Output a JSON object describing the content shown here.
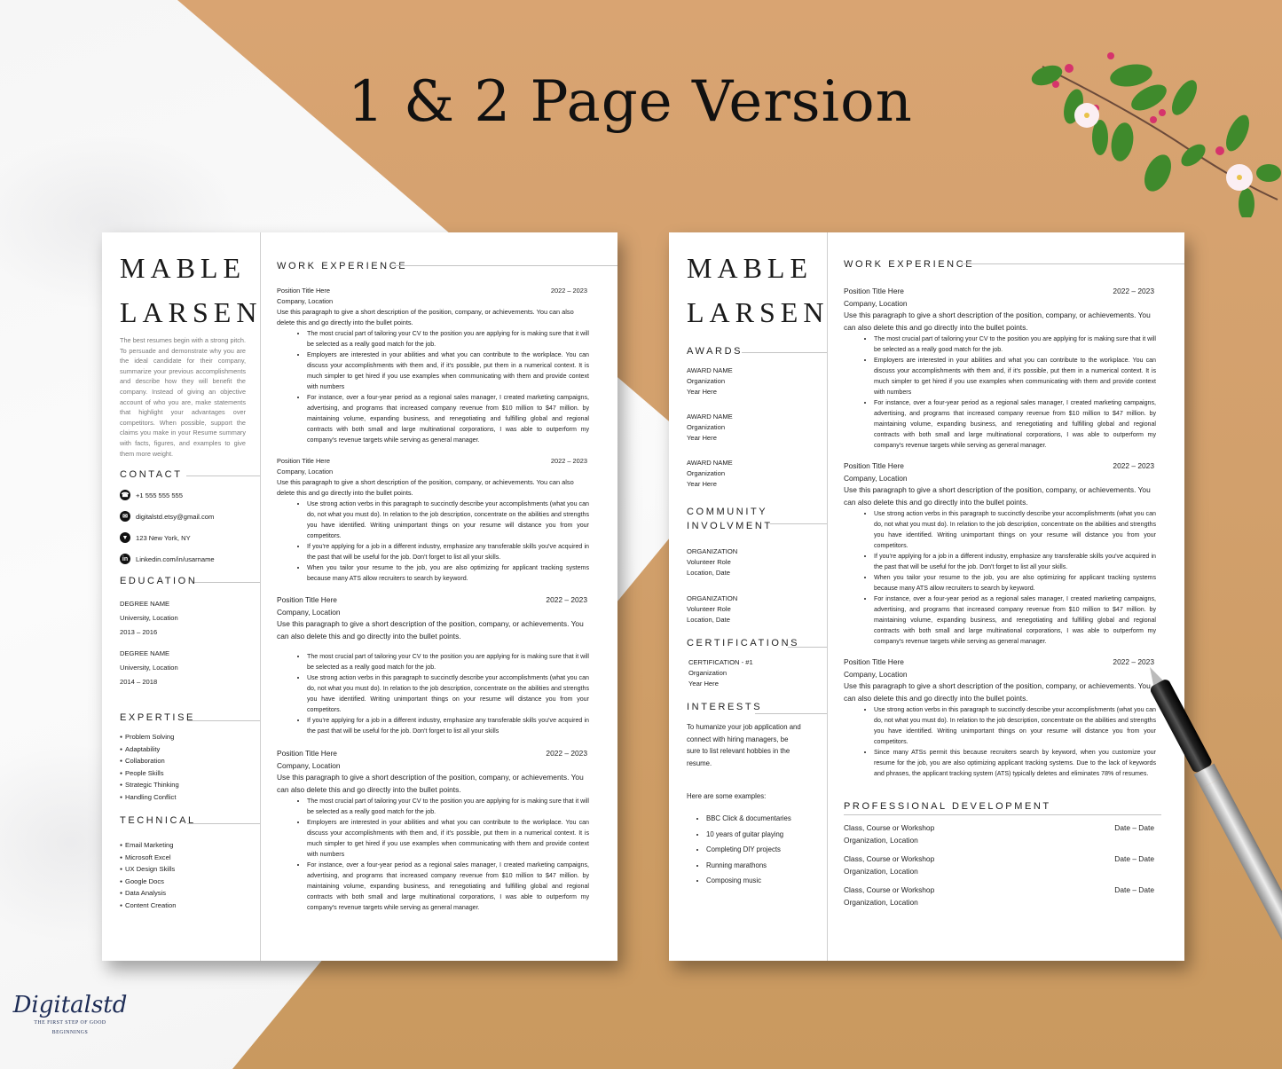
{
  "headline": "1 & 2 Page Version",
  "brand": {
    "name": "Digitalstd",
    "tagline_1": "THE FIRST STEP OF GOOD",
    "tagline_2": "BEGINNINGS",
    "color": "#1c2b55"
  },
  "colors": {
    "copper": "#d4a06d",
    "marble": "#f6f6f6",
    "text": "#222222",
    "summary_text": "#777777"
  },
  "person": {
    "first_name": "MABLE",
    "last_name": "LARSEN"
  },
  "page1": {
    "summary": "The best resumes begin with a strong pitch. To persuade and demonstrate why you are the ideal candidate for their company, summarize your previous accomplishments and describe how they will benefit the company. Instead of giving an objective account of who you are, make statements that highlight your advantages over competitors. When possible, support the claims you make in your Resume summary with facts, figures, and examples to give them more weight.",
    "contact_title": "CONTACT",
    "contact": [
      {
        "icon": "phone-icon",
        "glyph": "☎",
        "value": "+1 555 555 555"
      },
      {
        "icon": "email-icon",
        "glyph": "✉",
        "value": "digitalstd.etsy@gmail.com"
      },
      {
        "icon": "location-pin-icon",
        "glyph": "▼",
        "value": "123 New York, NY"
      },
      {
        "icon": "linkedin-icon",
        "glyph": "in",
        "value": "Linkedin.com/in/usarname"
      }
    ],
    "education_title": "EDUCATION",
    "education": [
      {
        "degree": "DEGREE NAME",
        "school": "University, Location",
        "years": "2013 – 2016"
      },
      {
        "degree": "DEGREE NAME",
        "school": "University, Location",
        "years": "2014 – 2018"
      }
    ],
    "expertise_title": "EXPERTISE",
    "expertise": [
      "Problem Solving",
      "Adaptability",
      "Collaboration",
      "People Skills",
      "Strategic Thinking",
      "Handling Conflict"
    ],
    "technical_title": "TECHNICAL",
    "technical": [
      "Email Marketing",
      "Microsoft Excel",
      "UX Design Skills",
      "Google Docs",
      "Data Analysis",
      "Content Creation"
    ],
    "work_title": "WORK EXPERIENCE",
    "jobs": [
      {
        "title": "Position Title Here",
        "dates": "2022 – 2023",
        "company": "Company, Location",
        "desc": "Use this paragraph to give a short description of the position, company, or achievements. You can also delete this and go directly into the bullet points.",
        "bullets": [
          "The most crucial part of tailoring your CV to the position you are applying for is making sure that it will be selected as a really good match for the job.",
          "Employers are interested in your abilities and what you can contribute to the workplace. You can discuss your accomplishments with them and, if it's possible, put them in a numerical context. It is much simpler to get hired if you use examples when communicating with them and provide context with numbers",
          "For instance, over a four-year period as a regional sales manager, I created marketing campaigns, advertising, and programs that increased company revenue from $10 million to $47 million. by maintaining volume, expanding business, and renegotiating and fulfilling global and regional contracts with both small and large multinational corporations, I was able to outperform my company's revenue targets while serving as general manager."
        ]
      },
      {
        "title": "Position Title Here",
        "dates": "2022 – 2023",
        "company": "Company, Location",
        "desc": "Use this paragraph to give a short description of the position, company, or achievements. You can also delete this and go directly into the bullet points.",
        "bullets": [
          "Use strong action verbs in this paragraph to succinctly describe your accomplishments (what you can do, not what you must do). In relation to the job description, concentrate on the abilities and strengths you have identified. Writing unimportant things on your resume will distance you from your competitors.",
          "If you're applying for a job in a different industry, emphasize any transferable skills you've acquired in the past that will be useful for the job. Don't forget to list all your skills.",
          "When you tailor your resume to the job, you are also optimizing for applicant tracking systems because many ATS allow recruiters to search by keyword."
        ]
      },
      {
        "title": "Position Title Here",
        "dates": "2022 – 2023",
        "company": "Company, Location",
        "desc": "Use this paragraph to give a short description of the position, company, or achievements. You can also delete this and go directly into the bullet points.",
        "bullets": [
          "The most crucial part of tailoring your CV to the position you are applying for is making sure that it will be selected as a really good match for the job.",
          "Use strong action verbs in this paragraph to succinctly describe your accomplishments (what you can do, not what you must do). In relation to the job description, concentrate on the abilities and strengths you have identified. Writing unimportant things on your resume will distance you from your competitors.",
          "If you're applying for a job in a different industry, emphasize any transferable skills you've acquired in the past that will be useful for the job. Don't forget to list all your skills"
        ]
      },
      {
        "title": "Position Title Here",
        "dates": "2022 – 2023",
        "company": "Company, Location",
        "desc": "Use this paragraph to give a short description of the position, company, or achievements. You can also delete this and go directly into the bullet points.",
        "bullets": [
          "The most crucial part of tailoring your CV to the position you are applying for is making sure that it will be selected as a really good match for the job.",
          "Employers are interested in your abilities and what you can contribute to the workplace. You can discuss your accomplishments with them and, if it's possible, put them in a numerical context. It is much simpler to get hired if you use examples when communicating with them and provide context with numbers",
          "For instance, over a four-year period as a regional sales manager, I created marketing campaigns, advertising, and programs that increased company revenue from $10 million to $47 million. by maintaining volume, expanding business, and renegotiating and fulfilling global and regional contracts with both small and large multinational corporations, I was able to outperform my company's revenue targets while serving as general manager."
        ]
      }
    ]
  },
  "page2": {
    "awards_title": "AWARDS",
    "awards": [
      {
        "name": "AWARD NAME",
        "org": "Organization",
        "year": "Year Here"
      },
      {
        "name": "AWARD NAME",
        "org": "Organization",
        "year": "Year Here"
      },
      {
        "name": "AWARD NAME",
        "org": "Organization",
        "year": "Year Here"
      }
    ],
    "community_title_1": "COMMUNITY",
    "community_title_2": "INVOLVMENT",
    "community": [
      {
        "org": "ORGANIZATION",
        "role": "Volunteer Role",
        "where": "Location, Date"
      },
      {
        "org": "ORGANIZATION",
        "role": "Volunteer Role",
        "where": "Location, Date"
      }
    ],
    "certifications_title": "CERTIFICATIONS",
    "certification": {
      "name": "CERTIFICATION - #1",
      "org": "Organization",
      "year": "Year Here"
    },
    "interests_title": "INTERESTS",
    "interests_intro": "To humanize your job application and connect with hiring managers, be sure to list relevant hobbies in the resume.",
    "interests_lead": "Here are some examples:",
    "interests": [
      "BBC Click & documentaries",
      "10 years of guitar playing",
      "Completing DIY projects",
      "Running marathons",
      "Composing music"
    ],
    "work_title": "WORK EXPERIENCE",
    "jobs": [
      {
        "title": "Position Title Here",
        "dates": "2022 – 2023",
        "company": "Company, Location",
        "desc": "Use this paragraph to give a short description of the position, company, or achievements. You can also delete this and go directly into the bullet points.",
        "bullets": [
          "The most crucial part of tailoring your CV to the position you are applying for is making sure that it will be selected as a really good match for the job.",
          "Employers are interested in your abilities and what you can contribute to the workplace. You can discuss your accomplishments with them and, if it's possible, put them in a numerical context. It is much simpler to get hired if you use examples when communicating with them and provide context with numbers",
          "For instance, over a four-year period as a regional sales manager, I created marketing campaigns, advertising, and programs that increased company revenue from $10 million to $47 million. by maintaining volume, expanding business, and renegotiating and fulfilling global and regional contracts with both small and large multinational corporations, I was able to outperform my company's revenue targets while serving as general manager."
        ]
      },
      {
        "title": "Position Title Here",
        "dates": "2022 – 2023",
        "company": "Company, Location",
        "desc": "Use this paragraph to give a short description of the position, company, or achievements. You can also delete this and go directly into the bullet points.",
        "bullets": [
          "Use strong action verbs in this paragraph to succinctly describe your accomplishments (what you can do, not what you must do). In relation to the job description, concentrate on the abilities and strengths you have identified. Writing unimportant things on your resume will distance you from your competitors.",
          "If you're applying for a job in a different industry, emphasize any transferable skills you've acquired in the past that will be useful for the job. Don't forget to list all your skills.",
          "When you tailor your resume to the job, you are also optimizing for applicant tracking systems because many ATS allow recruiters to search by keyword.",
          "For instance, over a four-year period as a regional sales manager, I created marketing campaigns, advertising, and programs that increased company revenue from $10 million to $47 million. by maintaining volume, expanding business, and renegotiating and fulfilling global and regional contracts with both small and large multinational corporations, I was able to outperform my company's revenue targets while serving as general manager."
        ]
      },
      {
        "title": "Position Title Here",
        "dates": "2022 – 2023",
        "company": "Company, Location",
        "desc": "Use this paragraph to give a short description of the position, company, or achievements. You can also delete this and go directly into the bullet points.",
        "bullets": [
          "Use strong action verbs in this paragraph to succinctly describe your accomplishments (what you can do, not what you must do). In relation to the job description, concentrate on the abilities and strengths you have identified. Writing unimportant things on your resume will distance you from your competitors.",
          "Since many ATSs permit this because recruiters search by keyword, when you customize your resume for the job, you are also optimizing applicant tracking systems. Due to the lack of keywords and phrases, the applicant tracking system (ATS) typically deletes and eliminates 78% of resumes."
        ]
      }
    ],
    "prodev_title": "PROFESSIONAL DEVELOPMENT",
    "prodev": [
      {
        "course": "Class, Course or Workshop",
        "org": "Organization, Location",
        "dates": "Date – Date"
      },
      {
        "course": "Class, Course or Workshop",
        "org": "Organization, Location",
        "dates": "Date – Date"
      },
      {
        "course": "Class, Course or Workshop",
        "org": "Organization, Location",
        "dates": "Date – Date"
      }
    ]
  }
}
